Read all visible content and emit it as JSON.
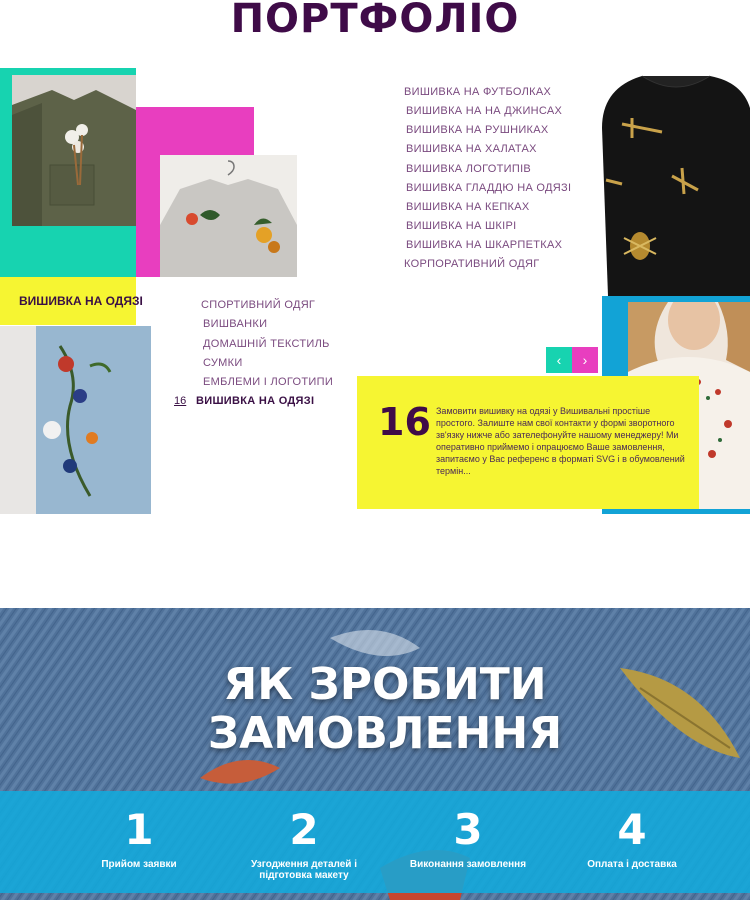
{
  "portfolio": {
    "title": "ПОРТФОЛІО",
    "featured_label": "ВИШИВКА НА ОДЯЗІ",
    "categories_right": [
      "ВИШИВКА НА ФУТБОЛКАХ",
      "ВИШИВКА НА НА ДЖИНСАХ",
      "ВИШИВКА НА РУШНИКАХ",
      "ВИШИВКА НА ХАЛАТАХ",
      "ВИШИВКА ЛОГОТИПІВ",
      "ВИШИВКА ГЛАДДЮ НА ОДЯЗІ",
      "ВИШИВКА НА КЕПКАХ",
      "ВИШИВКА НА ШКІРІ",
      "ВИШИВКА НА ШКАРПЕТКАХ",
      "КОРПОРАТИВНИЙ ОДЯГ"
    ],
    "categories_left": [
      "СПОРТИВНИЙ ОДЯГ",
      "ВИШВАНКИ",
      "ДОМАШНІЙ ТЕКСТИЛЬ",
      "СУМКИ",
      "ЕМБЛЕМИ І ЛОГОТИПИ"
    ],
    "active_category": {
      "number": "16",
      "label": "ВИШИВКА НА ОДЯЗІ"
    },
    "prev_icon": "chevron-left",
    "next_icon": "chevron-right",
    "card": {
      "number": "16",
      "text": "Замовити вишивку на одязі у Вишивальні простіше простого. Залиште нам свої контакти у формі зворотного зв'язку нижче або зателефонуйте нашому менеджеру! Ми оперативно приймемо і опрацюємо Ваше замовлення, запитаємо у Вас референс в форматі SVG і в обумовлений термін..."
    },
    "colors": {
      "teal": "#17d3b0",
      "pink": "#e83ebf",
      "yellow": "#f6f532",
      "blue": "#12a3d6",
      "title": "#3f0b48"
    }
  },
  "order": {
    "title_line1": "ЯК ЗРОБИТИ",
    "title_line2": "ЗАМОВЛЕННЯ",
    "steps": [
      {
        "number": "1",
        "label": "Прийом заявки"
      },
      {
        "number": "2",
        "label": "Узгодження деталей і підготовка макету"
      },
      {
        "number": "3",
        "label": "Виконання замовлення"
      },
      {
        "number": "4",
        "label": "Оплата і доставка"
      }
    ]
  }
}
